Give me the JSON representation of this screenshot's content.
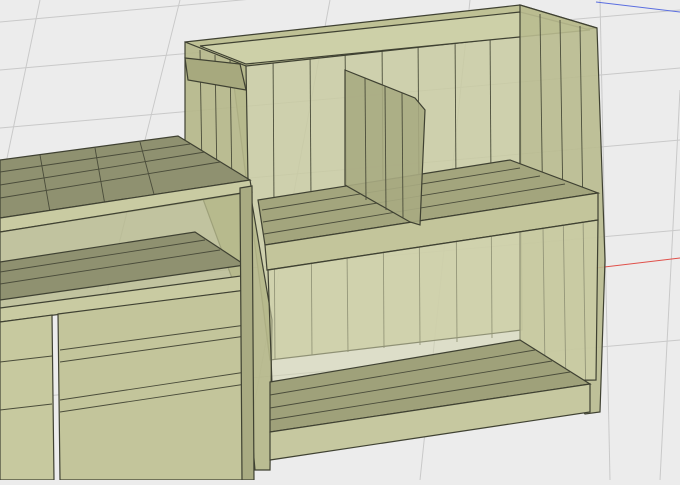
{
  "viewport": {
    "background": "#ececec",
    "grid_color": "#c9c9c9",
    "axis_x_color": "#e0504a",
    "axis_y_color": "#5a6ee0"
  },
  "model": {
    "fill_light": "#c9cba2",
    "fill_mid": "#b7b98c",
    "fill_dark": "#8f9170",
    "edge_color": "#3f4132"
  }
}
